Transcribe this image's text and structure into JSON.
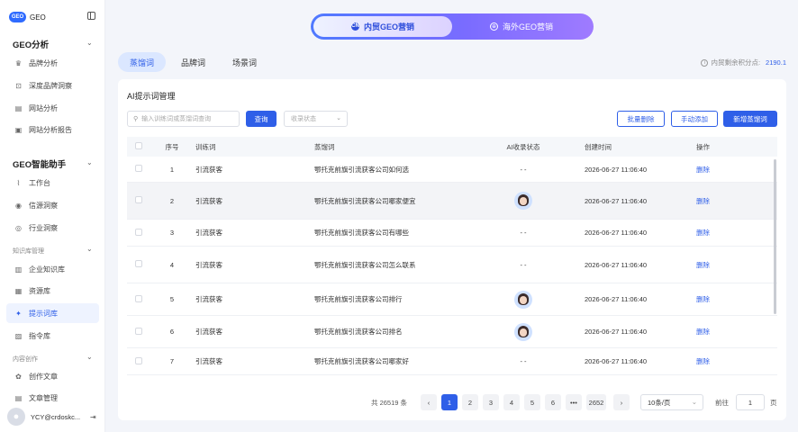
{
  "sidebar": {
    "logo_badge": "GEO",
    "logo_text": "GEO",
    "groups": {
      "analysis": {
        "title": "GEO分析",
        "items": [
          {
            "label": "品牌分析",
            "icon": "crown-icon"
          },
          {
            "label": "深度品牌洞察",
            "icon": "scan-icon"
          },
          {
            "label": "网站分析",
            "icon": "document-icon"
          },
          {
            "label": "网站分析报告",
            "icon": "report-icon"
          }
        ]
      },
      "assistant": {
        "title": "GEO智能助手",
        "items": [
          {
            "label": "工作台",
            "icon": "chart-icon"
          },
          {
            "label": "信源洞察",
            "icon": "eye-icon"
          },
          {
            "label": "行业洞察",
            "icon": "compass-icon"
          }
        ]
      },
      "knowledge": {
        "title": "知识库管理",
        "items": [
          {
            "label": "企业知识库",
            "icon": "book-icon"
          },
          {
            "label": "资源库",
            "icon": "box-icon"
          },
          {
            "label": "提示词库",
            "icon": "wand-icon"
          },
          {
            "label": "指令库",
            "icon": "command-icon"
          }
        ]
      },
      "content": {
        "title": "内容创作",
        "items": [
          {
            "label": "创作文章",
            "icon": "palette-icon"
          },
          {
            "label": "文章管理",
            "icon": "file-icon"
          }
        ]
      }
    },
    "user": {
      "name": "YCY@crdoskc..."
    }
  },
  "mode_switch": {
    "active": "内贸GEO营销",
    "inactive": "海外GEO营销",
    "active_icon": "CN",
    "inactive_icon": "⊕"
  },
  "tabs": [
    "蒸馏词",
    "品牌词",
    "场景词"
  ],
  "quota": {
    "label": "内贸剩余积分点:",
    "value": "2190.1"
  },
  "panel": {
    "title": "AI提示词管理",
    "search_placeholder": "输入训练词或蒸馏词查询",
    "search_button": "查询",
    "status_placeholder": "收录状态",
    "batch_delete": "批量删除",
    "manual_add": "手动添加",
    "add_distilled": "新增蒸馏词"
  },
  "table": {
    "headers": [
      "序号",
      "训练词",
      "蒸馏词",
      "AI收录状态",
      "创建时间",
      "操作"
    ],
    "rows": [
      {
        "idx": "1",
        "kw": "引流获客",
        "dist": "鄂托克前旗引流获客公司如何选",
        "ai": "- -",
        "time": "2026-06-27 11:06:40",
        "op": "删除"
      },
      {
        "idx": "2",
        "kw": "引流获客",
        "dist": "鄂托克前旗引流获客公司哪家便宜",
        "ai": "avatar",
        "time": "2026-06-27 11:06:40",
        "op": "删除"
      },
      {
        "idx": "3",
        "kw": "引流获客",
        "dist": "鄂托克前旗引流获客公司有哪些",
        "ai": "- -",
        "time": "2026-06-27 11:06:40",
        "op": "删除"
      },
      {
        "idx": "4",
        "kw": "引流获客",
        "dist": "鄂托克前旗引流获客公司怎么联系",
        "ai": "- -",
        "time": "2026-06-27 11:06:40",
        "op": "删除"
      },
      {
        "idx": "5",
        "kw": "引流获客",
        "dist": "鄂托克前旗引流获客公司排行",
        "ai": "avatar",
        "time": "2026-06-27 11:06:40",
        "op": "删除"
      },
      {
        "idx": "6",
        "kw": "引流获客",
        "dist": "鄂托克前旗引流获客公司排名",
        "ai": "avatar",
        "time": "2026-06-27 11:06:40",
        "op": "删除"
      },
      {
        "idx": "7",
        "kw": "引流获客",
        "dist": "鄂托克前旗引流获客公司哪家好",
        "ai": "- -",
        "time": "2026-06-27 11:06:40",
        "op": "删除"
      }
    ]
  },
  "pagination": {
    "total": "共 26519 条",
    "prev": "‹",
    "pages": [
      "1",
      "2",
      "3",
      "4",
      "5",
      "6",
      "•••",
      "2652"
    ],
    "next": "›",
    "current": "1",
    "page_size": "10条/页",
    "goto_label": "前往",
    "goto_value": "1",
    "page_suffix": "页"
  }
}
